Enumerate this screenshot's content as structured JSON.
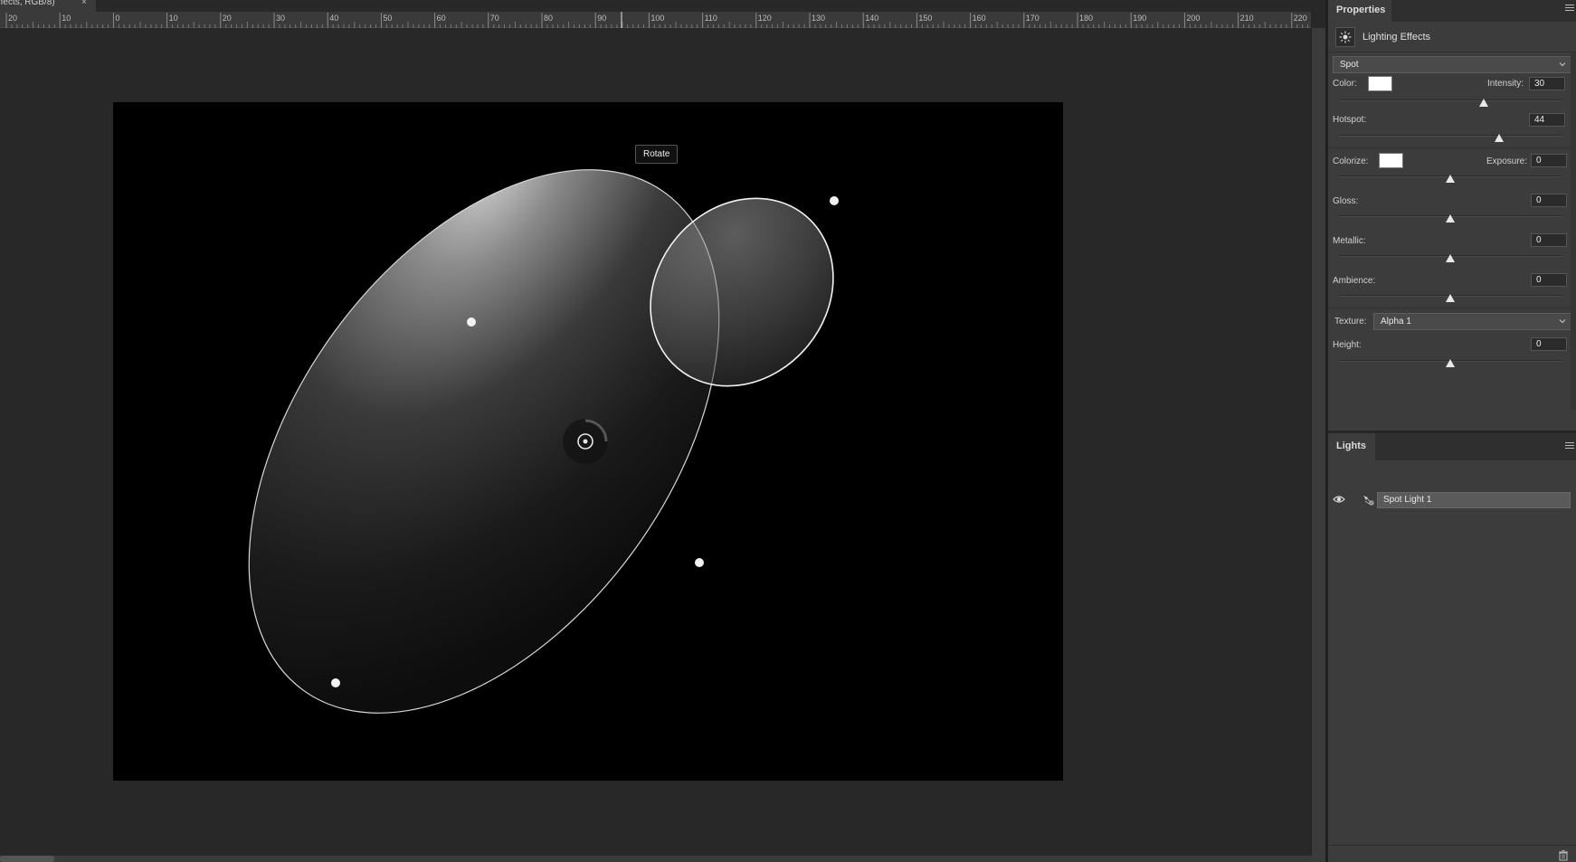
{
  "document_tab": {
    "title": "ffects, RGB/8)",
    "close_glyph": "×"
  },
  "ruler": {
    "labels": [
      "20",
      "10",
      "0",
      "10",
      "20",
      "30",
      "40",
      "50",
      "60",
      "70",
      "80",
      "90",
      "100",
      "110",
      "120",
      "130",
      "140",
      "150",
      "160",
      "170",
      "180",
      "190",
      "200",
      "210",
      "220"
    ]
  },
  "canvas": {
    "tooltip": "Rotate"
  },
  "properties": {
    "tab_label": "Properties",
    "header_title": "Lighting Effects",
    "header_icon": "lighting-effects-icon",
    "light_type": "Spot",
    "color_label": "Color:",
    "color_value": "#ffffff",
    "intensity_label": "Intensity:",
    "intensity_value": "30",
    "intensity_level": 0.65,
    "hotspot_label": "Hotspot:",
    "hotspot_value": "44",
    "hotspot_level": 0.72,
    "colorize_label": "Colorize:",
    "colorize_value": "#ffffff",
    "exposure_label": "Exposure:",
    "exposure_value": "0",
    "gloss_label": "Gloss:",
    "gloss_value": "0",
    "metallic_label": "Metallic:",
    "metallic_value": "0",
    "ambience_label": "Ambience:",
    "ambience_value": "0",
    "texture_label": "Texture:",
    "texture_value": "Alpha 1",
    "height_label": "Height:",
    "height_value": "0"
  },
  "lights": {
    "tab_label": "Lights",
    "items": [
      {
        "name": "Spot Light 1",
        "visible_icon": "eye-icon",
        "type_icon": "spot-light-icon"
      }
    ],
    "footer_icon": "trash-icon"
  },
  "colors": {
    "panel_bg": "#3c3c3c",
    "canvas_bg": "#282828",
    "document_bg": "#000000",
    "selection": "#5a5a5a"
  }
}
